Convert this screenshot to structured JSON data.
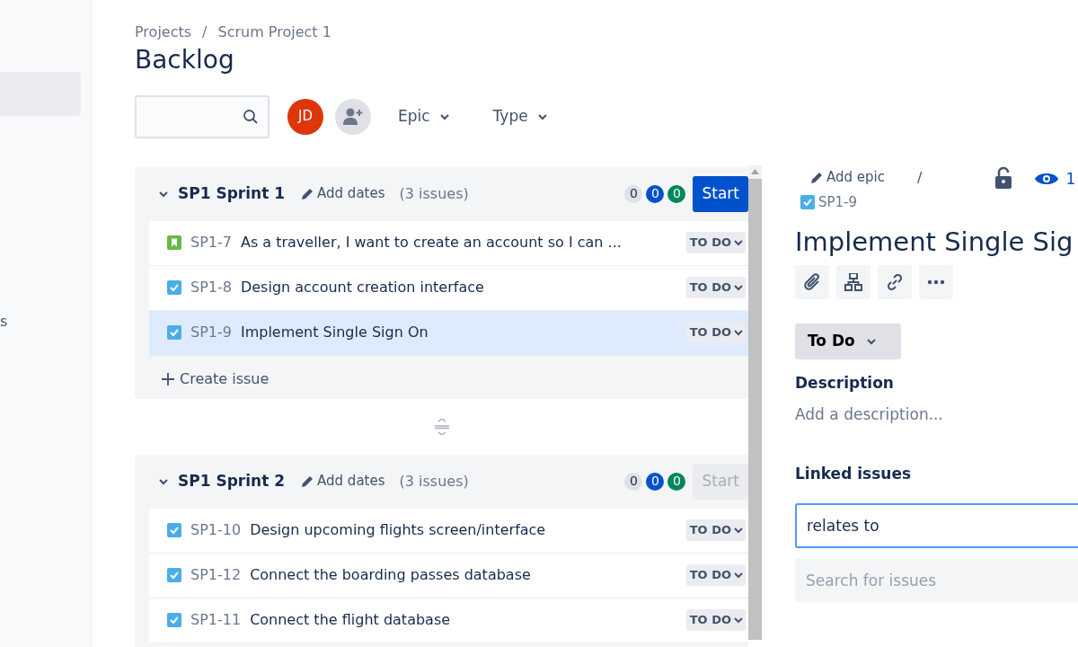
{
  "sidebar": {
    "items": [
      {
        "selected": true
      },
      {
        "label": "s",
        "selected": false
      }
    ]
  },
  "breadcrumbs": [
    "Projects",
    "Scrum Project 1"
  ],
  "breadcrumb_separator": "/",
  "page_title": "Backlog",
  "toolbar": {
    "avatars": [
      {
        "kind": "user",
        "initials": "JD"
      },
      {
        "kind": "add"
      }
    ],
    "filters": [
      "Epic",
      "Type"
    ]
  },
  "sprints": [
    {
      "name": "SP1 Sprint 1",
      "add_dates": "Add dates",
      "issue_count": "(3 issues)",
      "expanded": true,
      "counts": [
        {
          "value": "0",
          "color": "#dfe1e6"
        },
        {
          "value": "0",
          "color": "#0052cc"
        },
        {
          "value": "0",
          "color": "#00875a"
        }
      ],
      "start_button": {
        "label": "Start",
        "disabled": false
      },
      "issues": [
        {
          "kind": "story",
          "key": "SP1-7",
          "summary": "As a traveller, I want to create an account so I can ...",
          "status": "TO DO",
          "selected": false
        },
        {
          "kind": "task",
          "key": "SP1-8",
          "summary": "Design account creation interface",
          "status": "TO DO",
          "selected": false
        },
        {
          "kind": "task",
          "key": "SP1-9",
          "summary": "Implement Single Sign On",
          "status": "TO DO",
          "selected": true
        }
      ],
      "create_issue": "Create issue"
    },
    {
      "name": "SP1 Sprint 2",
      "add_dates": "Add dates",
      "issue_count": "(3 issues)",
      "expanded": true,
      "counts": [
        {
          "value": "0",
          "color": "#dfe1e6"
        },
        {
          "value": "0",
          "color": "#0052cc"
        },
        {
          "value": "0",
          "color": "#00875a"
        }
      ],
      "start_button": {
        "label": "Start",
        "disabled": true
      },
      "issues": [
        {
          "kind": "task",
          "key": "SP1-10",
          "summary": "Design upcoming flights screen/interface",
          "status": "TO DO",
          "selected": false
        },
        {
          "kind": "task",
          "key": "SP1-12",
          "summary": "Connect the boarding passes database",
          "status": "TO DO",
          "selected": false
        },
        {
          "kind": "task",
          "key": "SP1-11",
          "summary": "Connect the flight database",
          "status": "TO DO",
          "selected": false
        }
      ]
    }
  ],
  "detail": {
    "add_epic": "Add epic",
    "separator": "/",
    "issue_key": "SP1-9",
    "watchers": "1",
    "title": "Implement Single Sig",
    "status": "To Do",
    "description_label": "Description",
    "description_placeholder": "Add a description...",
    "linked_label": "Linked issues",
    "link_type": "relates to",
    "issue_search": {
      "placeholder": "Search for issues"
    }
  }
}
